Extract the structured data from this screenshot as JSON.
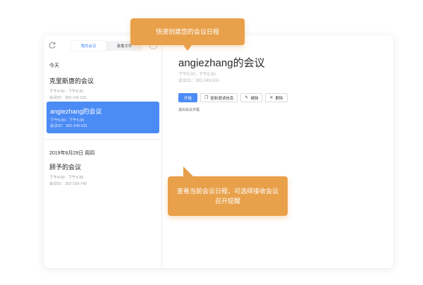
{
  "sidebar": {
    "tabs": [
      {
        "label": "我的会议",
        "active": true
      },
      {
        "label": "录像文件",
        "active": false
      }
    ],
    "sections": [
      {
        "label": "今天",
        "meetings": [
          {
            "title": "克里斯唐的会议",
            "time": "下午4:00 - 下午4:30",
            "meeting_id": "会议ID：392-191-531"
          },
          {
            "title": "angiezhang的会议",
            "time": "下午5:00 - 下午5:30",
            "meeting_id": "会议ID：392-249-531"
          }
        ]
      },
      {
        "label": "2019年8月29日 周四",
        "meetings": [
          {
            "title": "顾予的会议",
            "time": "下午4:00 - 下午4:30",
            "meeting_id": "会议ID：392-159-742"
          }
        ]
      }
    ]
  },
  "main": {
    "title": "angiezhang的会议",
    "time": "下午5:00 - 下午5:30",
    "meeting_id": "会议ID：392-249-531",
    "actions": {
      "start": "开始",
      "copy": "复制邀请信息",
      "edit": "编辑",
      "delete": "删除"
    },
    "link": "退出会议日程"
  },
  "tooltips": {
    "top": "快速创建您的会议日程",
    "bottom": "查看当前会议日程，可选择接收会议召开提醒"
  },
  "colors": {
    "accent": "#4b8bf5",
    "tooltip": "#e8a04a"
  }
}
